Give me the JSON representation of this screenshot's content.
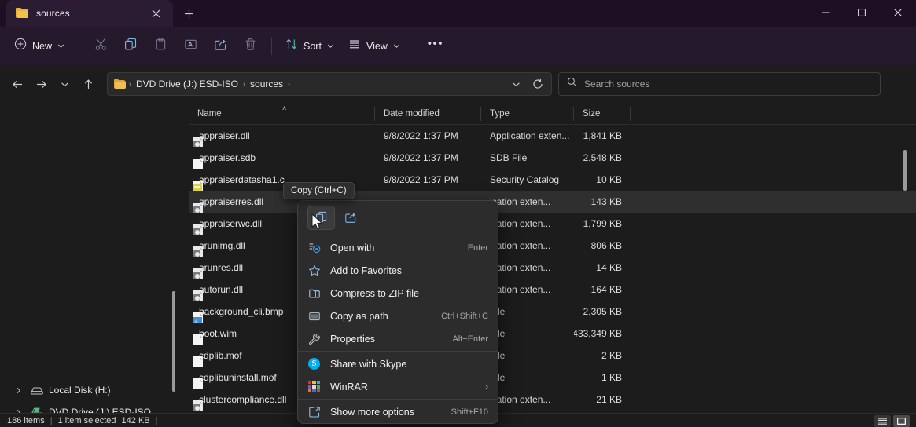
{
  "window": {
    "tab_title": "sources",
    "tab_icon": "folder-icon",
    "close_icon": "close-icon",
    "newtab_icon": "plus-icon",
    "minimize_icon": "minimize-icon",
    "maximize_icon": "maximize-icon",
    "window_close_icon": "close-icon"
  },
  "toolbar": {
    "new_label": "New",
    "new_icon": "plus-circle-icon",
    "cut_icon": "scissors-icon",
    "copy_icon": "copy-icon",
    "paste_icon": "paste-icon",
    "rename_icon": "rename-icon",
    "share_icon": "share-icon",
    "delete_icon": "trash-icon",
    "sort_label": "Sort",
    "sort_icon": "sort-arrows-icon",
    "view_label": "View",
    "view_icon": "list-lines-icon",
    "more_label": "•••",
    "chevron_icon": "chevron-down-icon"
  },
  "address": {
    "back_icon": "arrow-left-icon",
    "forward_icon": "arrow-right-icon",
    "recent_icon": "chevron-down-icon",
    "up_icon": "arrow-up-icon",
    "folder_icon": "folder-icon",
    "breadcrumbs": [
      "DVD Drive (J:) ESD-ISO",
      "sources"
    ],
    "separator": "›",
    "dropdown_icon": "chevron-down-icon",
    "refresh_icon": "refresh-icon"
  },
  "search": {
    "icon": "search-icon",
    "placeholder": "Search sources"
  },
  "navpane": {
    "items": [
      {
        "label": "Local Disk (H:)",
        "icon": "drive-icon",
        "chevron": "chevron-right-icon"
      },
      {
        "label": "DVD Drive (J:) ESD-ISO",
        "icon": "dvd-drive-icon",
        "chevron": "chevron-right-icon"
      }
    ]
  },
  "filelist": {
    "columns": [
      {
        "label": "Name",
        "sort_caret": "˄"
      },
      {
        "label": "Date modified"
      },
      {
        "label": "Type"
      },
      {
        "label": "Size"
      }
    ],
    "rows": [
      {
        "name": "appraiser.dll",
        "date": "9/8/2022 1:37 PM",
        "type": "Application exten...",
        "size": "1,841 KB",
        "icon": "dll-file-icon",
        "selected": false
      },
      {
        "name": "appraiser.sdb",
        "date": "9/8/2022 1:37 PM",
        "type": "SDB File",
        "size": "2,548 KB",
        "icon": "generic-file-icon",
        "selected": false
      },
      {
        "name": "appraiserdatasha1.c",
        "date": "9/8/2022 1:37 PM",
        "type": "Security Catalog",
        "size": "10 KB",
        "icon": "catalog-file-icon",
        "selected": false
      },
      {
        "name": "appraiserres.dll",
        "date": "",
        "type": "ication exten...",
        "size": "143 KB",
        "icon": "dll-file-icon",
        "selected": true
      },
      {
        "name": "appraiserwc.dll",
        "date": "",
        "type": "ication exten...",
        "size": "1,799 KB",
        "icon": "dll-file-icon",
        "selected": false
      },
      {
        "name": "arunimg.dll",
        "date": "",
        "type": "ication exten...",
        "size": "806 KB",
        "icon": "dll-file-icon",
        "selected": false
      },
      {
        "name": "arunres.dll",
        "date": "",
        "type": "ication exten...",
        "size": "14 KB",
        "icon": "dll-file-icon",
        "selected": false
      },
      {
        "name": "autorun.dll",
        "date": "",
        "type": "ication exten...",
        "size": "164 KB",
        "icon": "dll-file-icon",
        "selected": false
      },
      {
        "name": "background_cli.bmp",
        "date": "",
        "type": "File",
        "size": "2,305 KB",
        "icon": "bitmap-file-icon",
        "selected": false
      },
      {
        "name": "boot.wim",
        "date": "",
        "type": "File",
        "size": "433,349 KB",
        "icon": "generic-file-icon",
        "selected": false
      },
      {
        "name": "cdplib.mof",
        "date": "",
        "type": "File",
        "size": "2 KB",
        "icon": "generic-file-icon",
        "selected": false
      },
      {
        "name": "cdplibuninstall.mof",
        "date": "",
        "type": "File",
        "size": "1 KB",
        "icon": "generic-file-icon",
        "selected": false
      },
      {
        "name": "clustercompliance.dll",
        "date": "",
        "type": "ication exten...",
        "size": "21 KB",
        "icon": "dll-file-icon",
        "selected": false
      }
    ]
  },
  "tooltip": {
    "text": "Copy (Ctrl+C)"
  },
  "contextmenu": {
    "quick_actions": [
      {
        "name": "copy",
        "icon": "copy-icon",
        "active": true
      },
      {
        "name": "share",
        "icon": "share-icon",
        "active": false
      }
    ],
    "items": [
      {
        "label": "Open with",
        "accel": "Enter",
        "icon": "open-with-icon",
        "submenu": false
      },
      {
        "label": "Add to Favorites",
        "accel": "",
        "icon": "star-icon",
        "submenu": false
      },
      {
        "label": "Compress to ZIP file",
        "accel": "",
        "icon": "zip-folder-icon",
        "submenu": false
      },
      {
        "label": "Copy as path",
        "accel": "Ctrl+Shift+C",
        "icon": "copy-path-icon",
        "submenu": false
      },
      {
        "label": "Properties",
        "accel": "Alt+Enter",
        "icon": "wrench-icon",
        "submenu": false
      }
    ],
    "items2": [
      {
        "label": "Share with Skype",
        "accel": "",
        "icon": "skype-icon",
        "submenu": false
      },
      {
        "label": "WinRAR",
        "accel": "",
        "icon": "winrar-icon",
        "submenu": true,
        "submenu_glyph": "›"
      }
    ],
    "items3": [
      {
        "label": "Show more options",
        "accel": "Shift+F10",
        "icon": "more-options-icon",
        "submenu": false
      }
    ]
  },
  "statusbar": {
    "item_count": "186 items",
    "selection": "1 item selected",
    "selection_size": "142 KB",
    "separator": "|",
    "details_view_icon": "details-view-icon",
    "preview_pane_icon": "preview-pane-icon"
  },
  "colors": {
    "titlebar_bg": "#1e0f23",
    "cmdbar_bg": "#241a2b",
    "body_bg": "#1c1c1c",
    "menu_bg": "#2c2c2c",
    "accent": "#76b9ed",
    "folder_yellow": "#f2c14e",
    "selected_row": "#2f2f2f"
  }
}
